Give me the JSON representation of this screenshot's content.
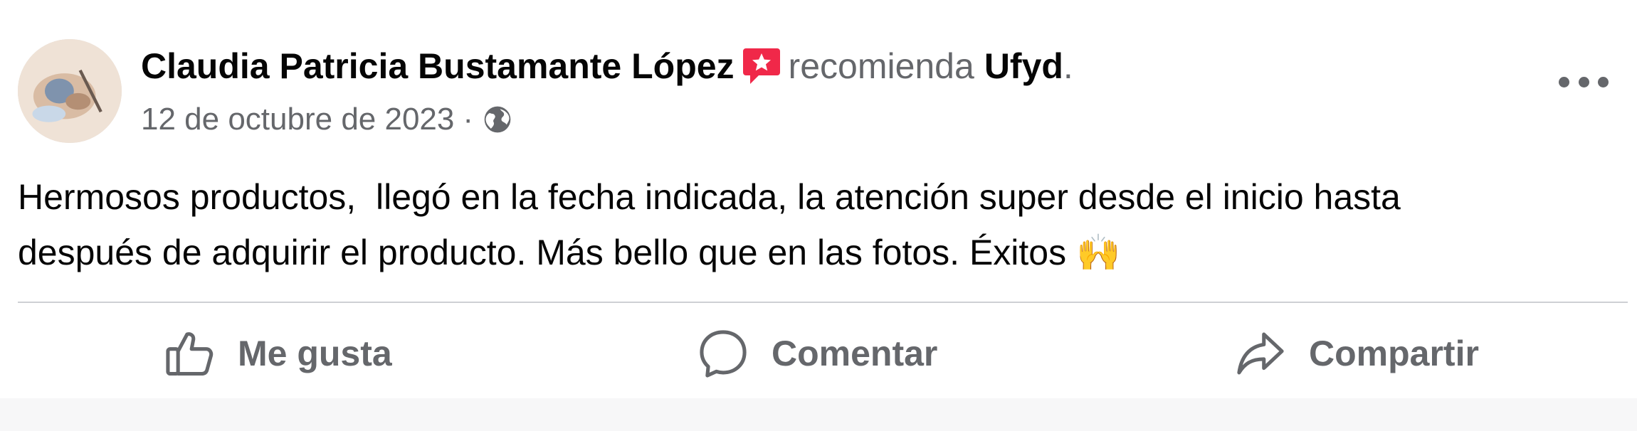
{
  "post": {
    "author": "Claudia Patricia Bustamante López",
    "verb": "recomienda",
    "page": "Ufyd",
    "period": ".",
    "date": "12 de octubre de 2023",
    "separator": "·",
    "privacy_icon": "globe-icon",
    "recommend_icon": "recommend-star-icon",
    "more_icon": "more-options-icon",
    "text": "Hermosos productos,  llegó en la fecha indicada, la atención super desde el inicio hasta\ndespués de adquirir el producto. Más bello que en las fotos. Éxitos 🙌"
  },
  "actions": {
    "like": {
      "label": "Me gusta",
      "icon": "thumbs-up-icon"
    },
    "comment": {
      "label": "Comentar",
      "icon": "comment-icon"
    },
    "share": {
      "label": "Compartir",
      "icon": "share-icon"
    }
  },
  "colors": {
    "recommend_red": "#f02849",
    "secondary_text": "#65676b",
    "primary_text": "#050505"
  }
}
